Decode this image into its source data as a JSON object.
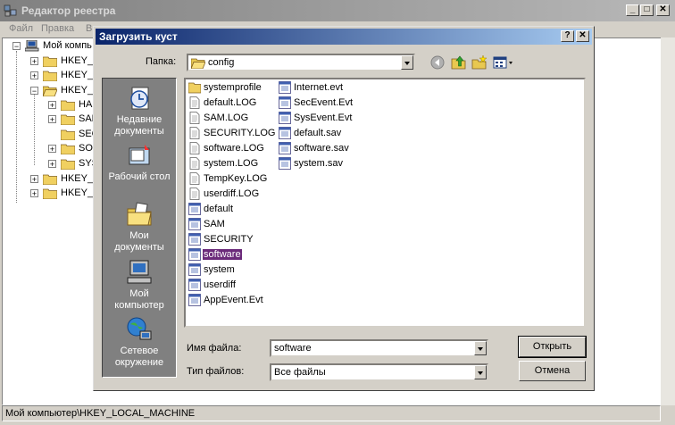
{
  "regedit": {
    "title": "Редактор реестра",
    "menu": [
      "Файл",
      "Правка",
      "В"
    ],
    "tree": {
      "root": "Мой компь",
      "nodes": [
        "HKEY_C",
        "HKEY_C",
        "HKEY_L",
        "HAR",
        "SAM",
        "SEC",
        "SOF",
        "SYS",
        "HKEY_U",
        "HKEY_C"
      ]
    },
    "status": "Мой компьютер\\HKEY_LOCAL_MACHINE"
  },
  "dialog": {
    "title": "Загрузить куст",
    "help_btn": "?",
    "close_btn": "✕",
    "folder_label": "Папка:",
    "folder_value": "config",
    "places": [
      {
        "label1": "Недавние",
        "label2": "документы",
        "icon": "recent-docs-icon"
      },
      {
        "label1": "Рабочий стол",
        "label2": "",
        "icon": "desktop-icon"
      },
      {
        "label1": "Мои",
        "label2": "документы",
        "icon": "my-documents-icon"
      },
      {
        "label1": "Мой",
        "label2": "компьютер",
        "icon": "my-computer-icon"
      },
      {
        "label1": "Сетевое",
        "label2": "окружение",
        "icon": "network-icon"
      }
    ],
    "files_col1": [
      {
        "name": "systemprofile",
        "type": "folder"
      },
      {
        "name": "default.LOG",
        "type": "text"
      },
      {
        "name": "SAM.LOG",
        "type": "text"
      },
      {
        "name": "SECURITY.LOG",
        "type": "text"
      },
      {
        "name": "software.LOG",
        "type": "text"
      },
      {
        "name": "system.LOG",
        "type": "text"
      },
      {
        "name": "TempKey.LOG",
        "type": "text"
      },
      {
        "name": "userdiff.LOG",
        "type": "text"
      },
      {
        "name": "default",
        "type": "hive"
      },
      {
        "name": "SAM",
        "type": "hive"
      },
      {
        "name": "SECURITY",
        "type": "hive"
      },
      {
        "name": "software",
        "type": "hive",
        "selected": true
      },
      {
        "name": "system",
        "type": "hive"
      },
      {
        "name": "userdiff",
        "type": "hive"
      },
      {
        "name": "AppEvent.Evt",
        "type": "hive"
      }
    ],
    "files_col2": [
      {
        "name": "Internet.evt",
        "type": "hive"
      },
      {
        "name": "SecEvent.Evt",
        "type": "hive"
      },
      {
        "name": "SysEvent.Evt",
        "type": "hive"
      },
      {
        "name": "default.sav",
        "type": "hive"
      },
      {
        "name": "software.sav",
        "type": "hive"
      },
      {
        "name": "system.sav",
        "type": "hive"
      }
    ],
    "file_name_label": "Имя файла:",
    "file_name_value": "software",
    "file_type_label": "Тип файлов:",
    "file_type_value": "Все файлы",
    "open_label": "Открыть",
    "cancel_label": "Отмена"
  }
}
